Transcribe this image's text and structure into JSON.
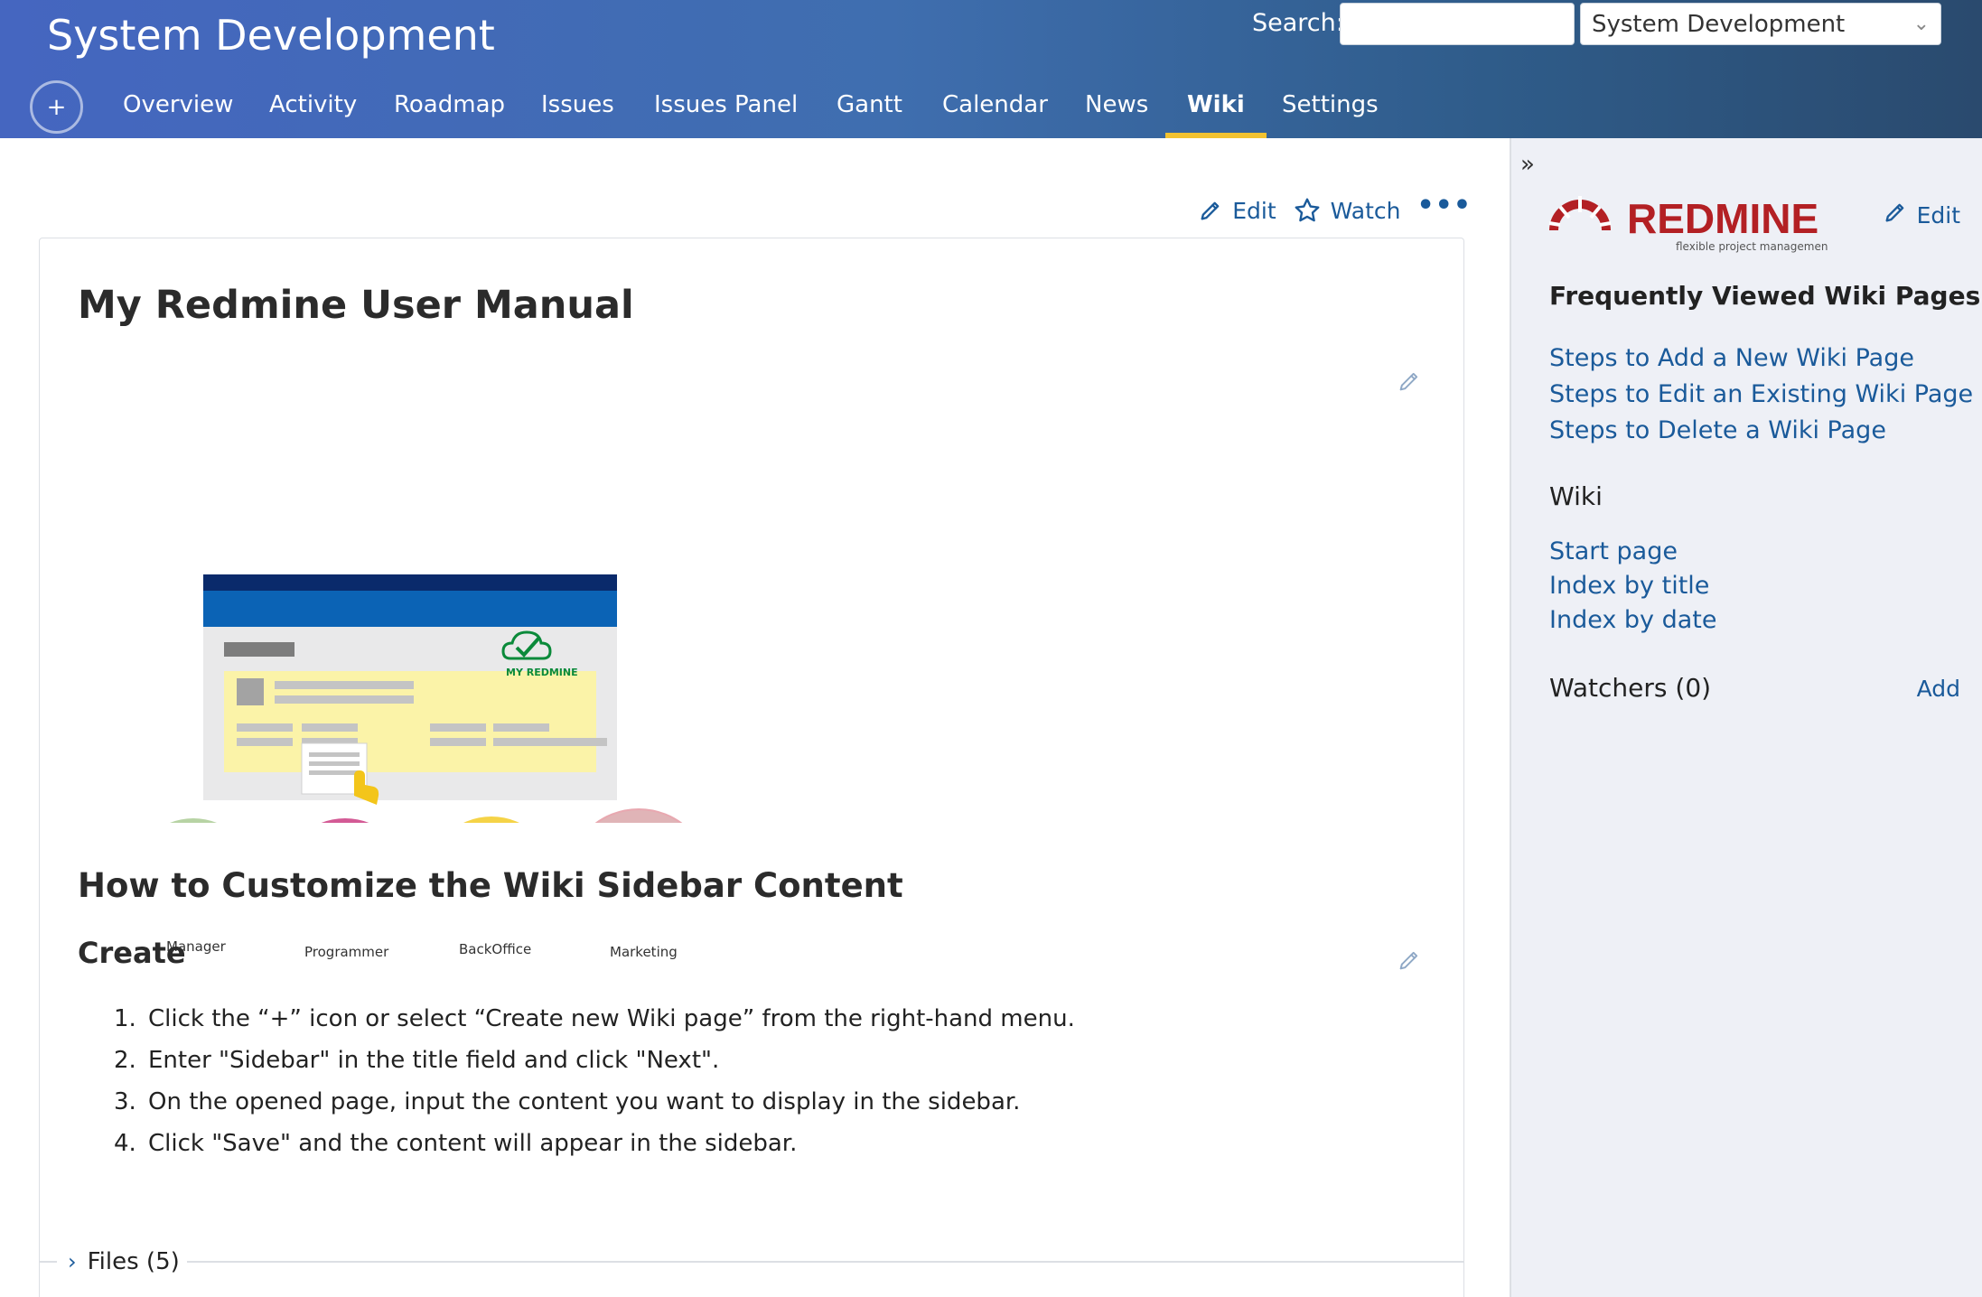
{
  "header": {
    "project_title": "System Development",
    "search_label": "Search:",
    "search_value": "",
    "project_select": "System Development"
  },
  "menu": {
    "new_object": "+",
    "tabs": [
      {
        "label": "Overview"
      },
      {
        "label": "Activity"
      },
      {
        "label": "Roadmap"
      },
      {
        "label": "Issues"
      },
      {
        "label": "Issues Panel"
      },
      {
        "label": "Gantt"
      },
      {
        "label": "Calendar"
      },
      {
        "label": "News"
      },
      {
        "label": "Wiki",
        "selected": true
      },
      {
        "label": "Settings"
      }
    ]
  },
  "contextual": {
    "edit": "Edit",
    "watch": "Watch",
    "more": "•••"
  },
  "wiki": {
    "title": "My Redmine User Manual",
    "hero": {
      "brand": "MY REDMINE",
      "roles": [
        "Manager",
        "Programmer",
        "BackOffice",
        "Marketing"
      ]
    },
    "section_heading": "How to Customize the Wiki Sidebar Content",
    "create_heading": "Create",
    "steps": [
      {
        "num": "1.",
        "text": "Click the “+” icon or select “Create new Wiki page” from the right-hand menu."
      },
      {
        "num": "2.",
        "text": "Enter \"Sidebar\" in the title field and click \"Next\"."
      },
      {
        "num": "3.",
        "text": "On the opened page, input the content you want to display in the sidebar."
      },
      {
        "num": "4.",
        "text": "Click \"Save\" and the content will appear in the sidebar."
      }
    ],
    "files": "Files (5)"
  },
  "sidebar": {
    "toggle": "»",
    "logo_text": "REDMINE",
    "logo_tagline": "flexible project management",
    "edit": "Edit",
    "frequent_heading": "Frequently Viewed Wiki Pages",
    "frequent_links": [
      "Steps to Add a New Wiki Page",
      "Steps to Edit an Existing Wiki Page",
      "Steps to Delete a Wiki Page"
    ],
    "wiki_heading": "Wiki",
    "wiki_links": [
      "Start page",
      "Index by title",
      "Index by date"
    ],
    "watchers_heading": "Watchers (0)",
    "watchers_add": "Add"
  },
  "colors": {
    "header_start": "#4566c0",
    "header_end": "#2a4a6e",
    "link": "#1a5a9a",
    "selected_tab_underline": "#f2c230",
    "redmine_red": "#b32024",
    "sidebar_bg": "#eef0f6"
  }
}
